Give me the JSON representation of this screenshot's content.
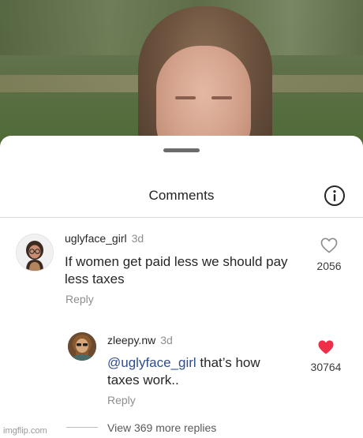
{
  "sheet": {
    "title": "Comments"
  },
  "comments": [
    {
      "username": "uglyface_girl",
      "time": "3d",
      "text_line1": "If women get paid less we should pay",
      "text_line2": "less taxes",
      "reply_label": "Reply",
      "like_count": "2056",
      "liked": false
    }
  ],
  "reply": {
    "username": "zleepy.nw",
    "time": "3d",
    "mention": "@uglyface_girl",
    "text_line1_rest": " that’s how",
    "text_line2": "taxes work..",
    "reply_label": "Reply",
    "like_count": "30764",
    "liked": true,
    "like_color": "#ed2f4a"
  },
  "view_more_label": "View 369 more replies",
  "watermark": "imgflip.com",
  "icons": {
    "info": "info-icon",
    "heart_outline": "heart-outline-icon",
    "heart_filled": "heart-filled-icon"
  }
}
